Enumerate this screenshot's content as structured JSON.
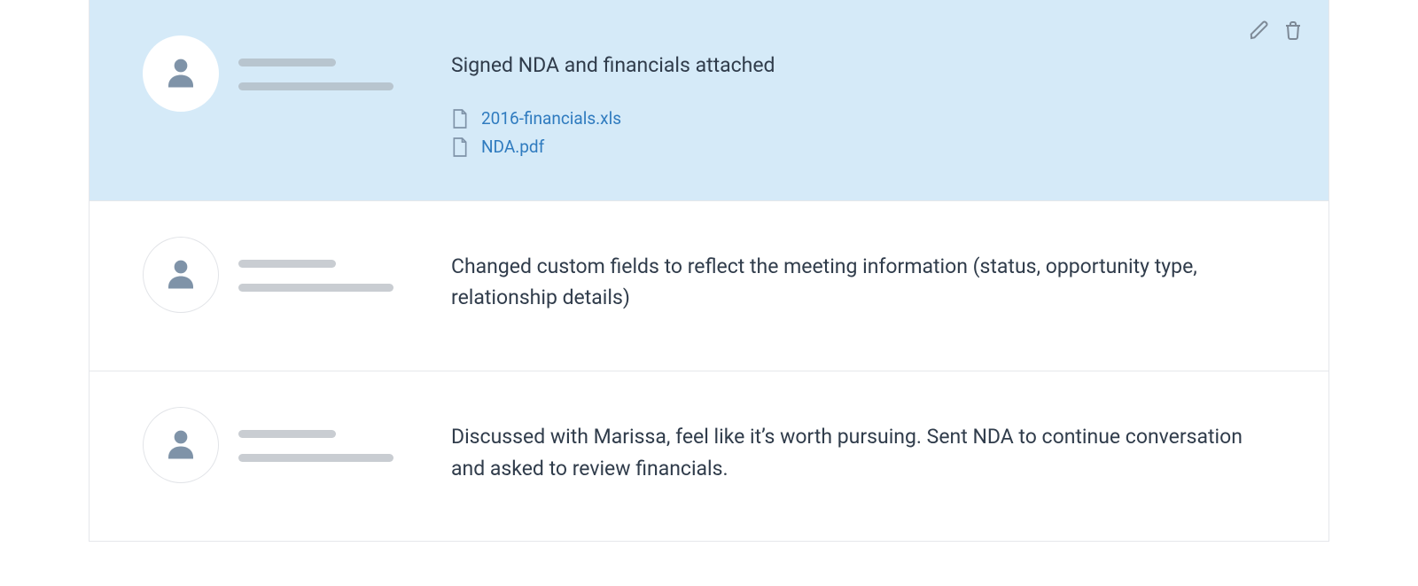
{
  "colors": {
    "highlight_bg": "#d5eaf8",
    "link": "#2f7bbf",
    "text": "#303c4b"
  },
  "activities": [
    {
      "text": "Signed NDA and financials attached",
      "attachments": [
        {
          "name": "2016-financials.xls"
        },
        {
          "name": "NDA.pdf"
        }
      ],
      "selected": true
    },
    {
      "text": "Changed custom fields to reflect the meeting information (status, opportunity type, relationship details)",
      "attachments": [],
      "selected": false
    },
    {
      "text": "Discussed with Marissa, feel like it’s worth pursuing. Sent NDA to continue conversation and asked to review financials.",
      "attachments": [],
      "selected": false
    }
  ]
}
